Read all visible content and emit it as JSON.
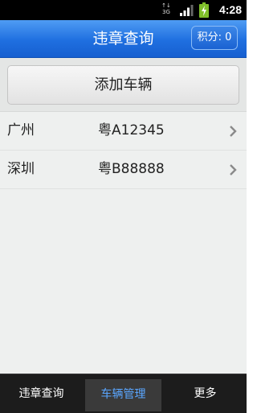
{
  "status_bar": {
    "network": "3G",
    "network_top": "↑↓",
    "time": "4:28"
  },
  "header": {
    "title": "违章查询",
    "points_button": "积分: 0"
  },
  "actions": {
    "add_vehicle": "添加车辆"
  },
  "vehicles": [
    {
      "city": "广州",
      "plate": "粤A12345"
    },
    {
      "city": "深圳",
      "plate": "粤B88888"
    }
  ],
  "tabs": [
    {
      "label": "违章查询",
      "active": false
    },
    {
      "label": "车辆管理",
      "active": true
    },
    {
      "label": "更多",
      "active": false
    }
  ],
  "colors": {
    "header_blue": "#1f6fe0",
    "active_tab_text": "#5aa6ff"
  }
}
